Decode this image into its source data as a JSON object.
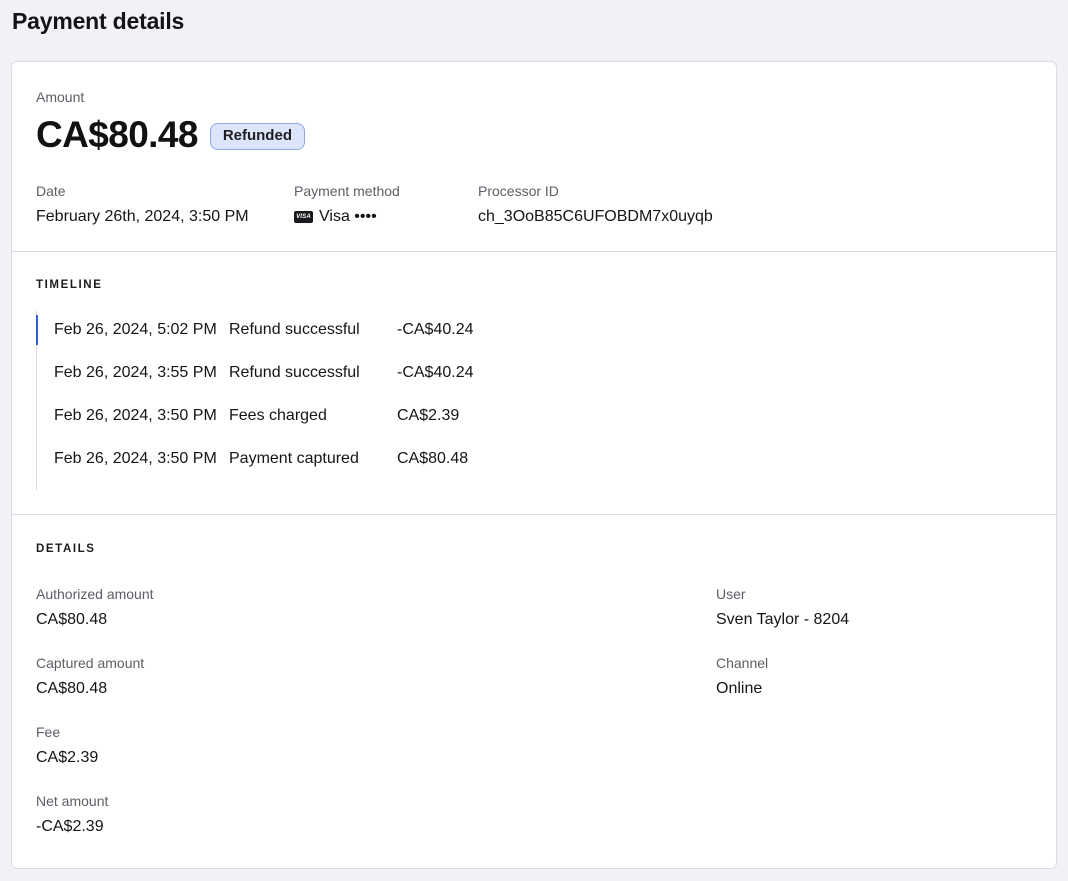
{
  "page": {
    "title": "Payment details"
  },
  "summary": {
    "amount_label": "Amount",
    "amount_value": "CA$80.48",
    "status_badge": "Refunded",
    "date_label": "Date",
    "date_value": "February 26th, 2024, 3:50 PM",
    "payment_method_label": "Payment method",
    "payment_method_icon": "visa-card-icon",
    "payment_method_icon_text": "VISA",
    "payment_method_value": "Visa ••••",
    "processor_id_label": "Processor ID",
    "processor_id_value": "ch_3OoB85C6UFOBDM7x0uyqb"
  },
  "timeline": {
    "heading": "TIMELINE",
    "items": [
      {
        "date": "Feb 26, 2024, 5:02 PM",
        "description": "Refund successful",
        "amount": "-CA$40.24"
      },
      {
        "date": "Feb 26, 2024, 3:55 PM",
        "description": "Refund successful",
        "amount": "-CA$40.24"
      },
      {
        "date": "Feb 26, 2024, 3:50 PM",
        "description": "Fees charged",
        "amount": "CA$2.39"
      },
      {
        "date": "Feb 26, 2024, 3:50 PM",
        "description": "Payment captured",
        "amount": "CA$80.48"
      }
    ]
  },
  "details": {
    "heading": "DETAILS",
    "authorized_amount_label": "Authorized amount",
    "authorized_amount_value": "CA$80.48",
    "captured_amount_label": "Captured amount",
    "captured_amount_value": "CA$80.48",
    "fee_label": "Fee",
    "fee_value": "CA$2.39",
    "net_amount_label": "Net amount",
    "net_amount_value": "-CA$2.39",
    "user_label": "User",
    "user_value": "Sven Taylor - 8204",
    "channel_label": "Channel",
    "channel_value": "Online"
  },
  "colors": {
    "background": "#f2f1f6",
    "card": "#ffffff",
    "badge_background": "#dde5fb",
    "badge_border": "#8ea6ea",
    "timeline_active": "#2f5fd0"
  }
}
